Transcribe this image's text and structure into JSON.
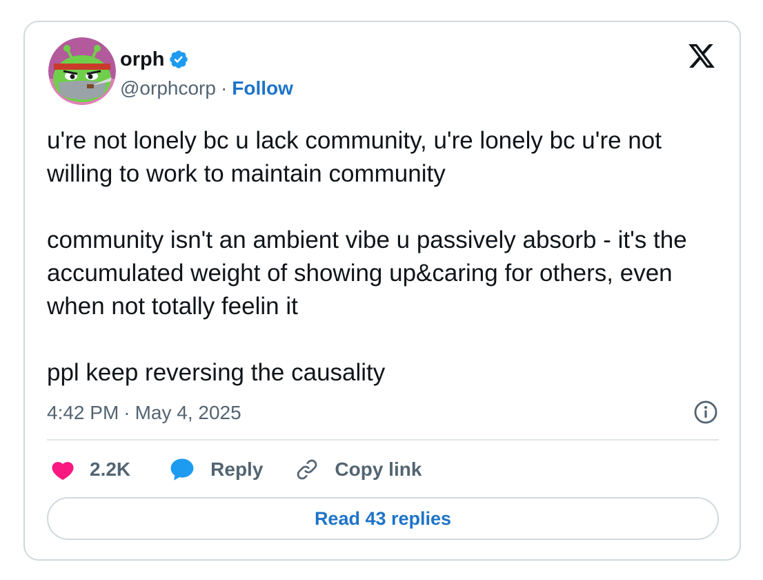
{
  "author": {
    "display_name": "orph",
    "handle": "@orphcorp",
    "separator": "·",
    "follow_label": "Follow",
    "verified": true
  },
  "tweet": {
    "paragraphs": [
      "u're not lonely bc u lack community, u're lonely bc u're not willing to work to maintain community",
      "community isn't an ambient vibe u passively absorb - it's the accumulated weight of showing up&caring for others, even when not totally feelin it",
      "ppl keep reversing the causality"
    ],
    "time": "4:42 PM",
    "separator": "·",
    "date": "May 4, 2025"
  },
  "actions": {
    "like_count": "2.2K",
    "reply_label": "Reply",
    "copy_label": "Copy link"
  },
  "read_replies_label": "Read 43 replies",
  "icons": {
    "logo": "x-logo-icon",
    "verified": "verified-badge-icon",
    "info": "info-icon",
    "like": "heart-icon",
    "reply": "speech-bubble-icon",
    "copy": "link-icon"
  },
  "colors": {
    "accent": "#1d73c9",
    "verified": "#1d9bf0",
    "heart": "#f91880",
    "secondary_text": "#536471",
    "border": "#cfd9de"
  }
}
